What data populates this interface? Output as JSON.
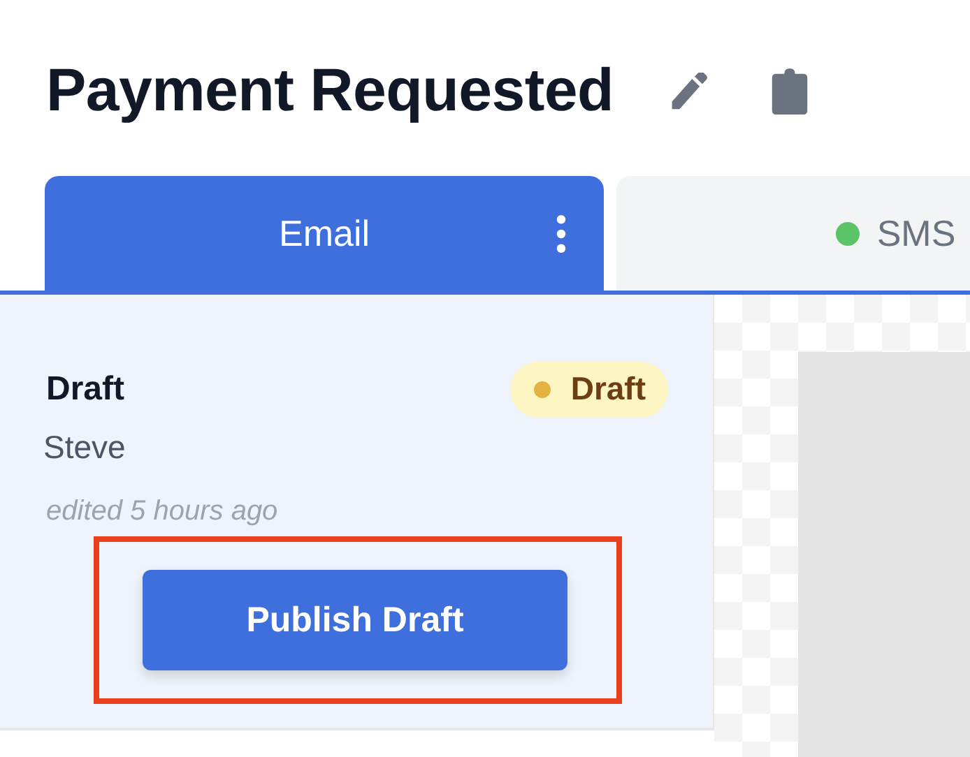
{
  "page": {
    "title": "Payment Requested"
  },
  "tabs": [
    {
      "label": "Email",
      "selected": true,
      "has_menu": true
    },
    {
      "label": "SMS",
      "selected": false,
      "has_menu": false,
      "color": "#5ac466"
    }
  ],
  "draft": {
    "title": "Draft",
    "author": "Steve",
    "edited": "edited 5 hours ago",
    "badge": {
      "label": "Draft",
      "color": "#e3b341"
    }
  },
  "publish_button": {
    "label": "Publish Draft",
    "highlighted": true
  }
}
